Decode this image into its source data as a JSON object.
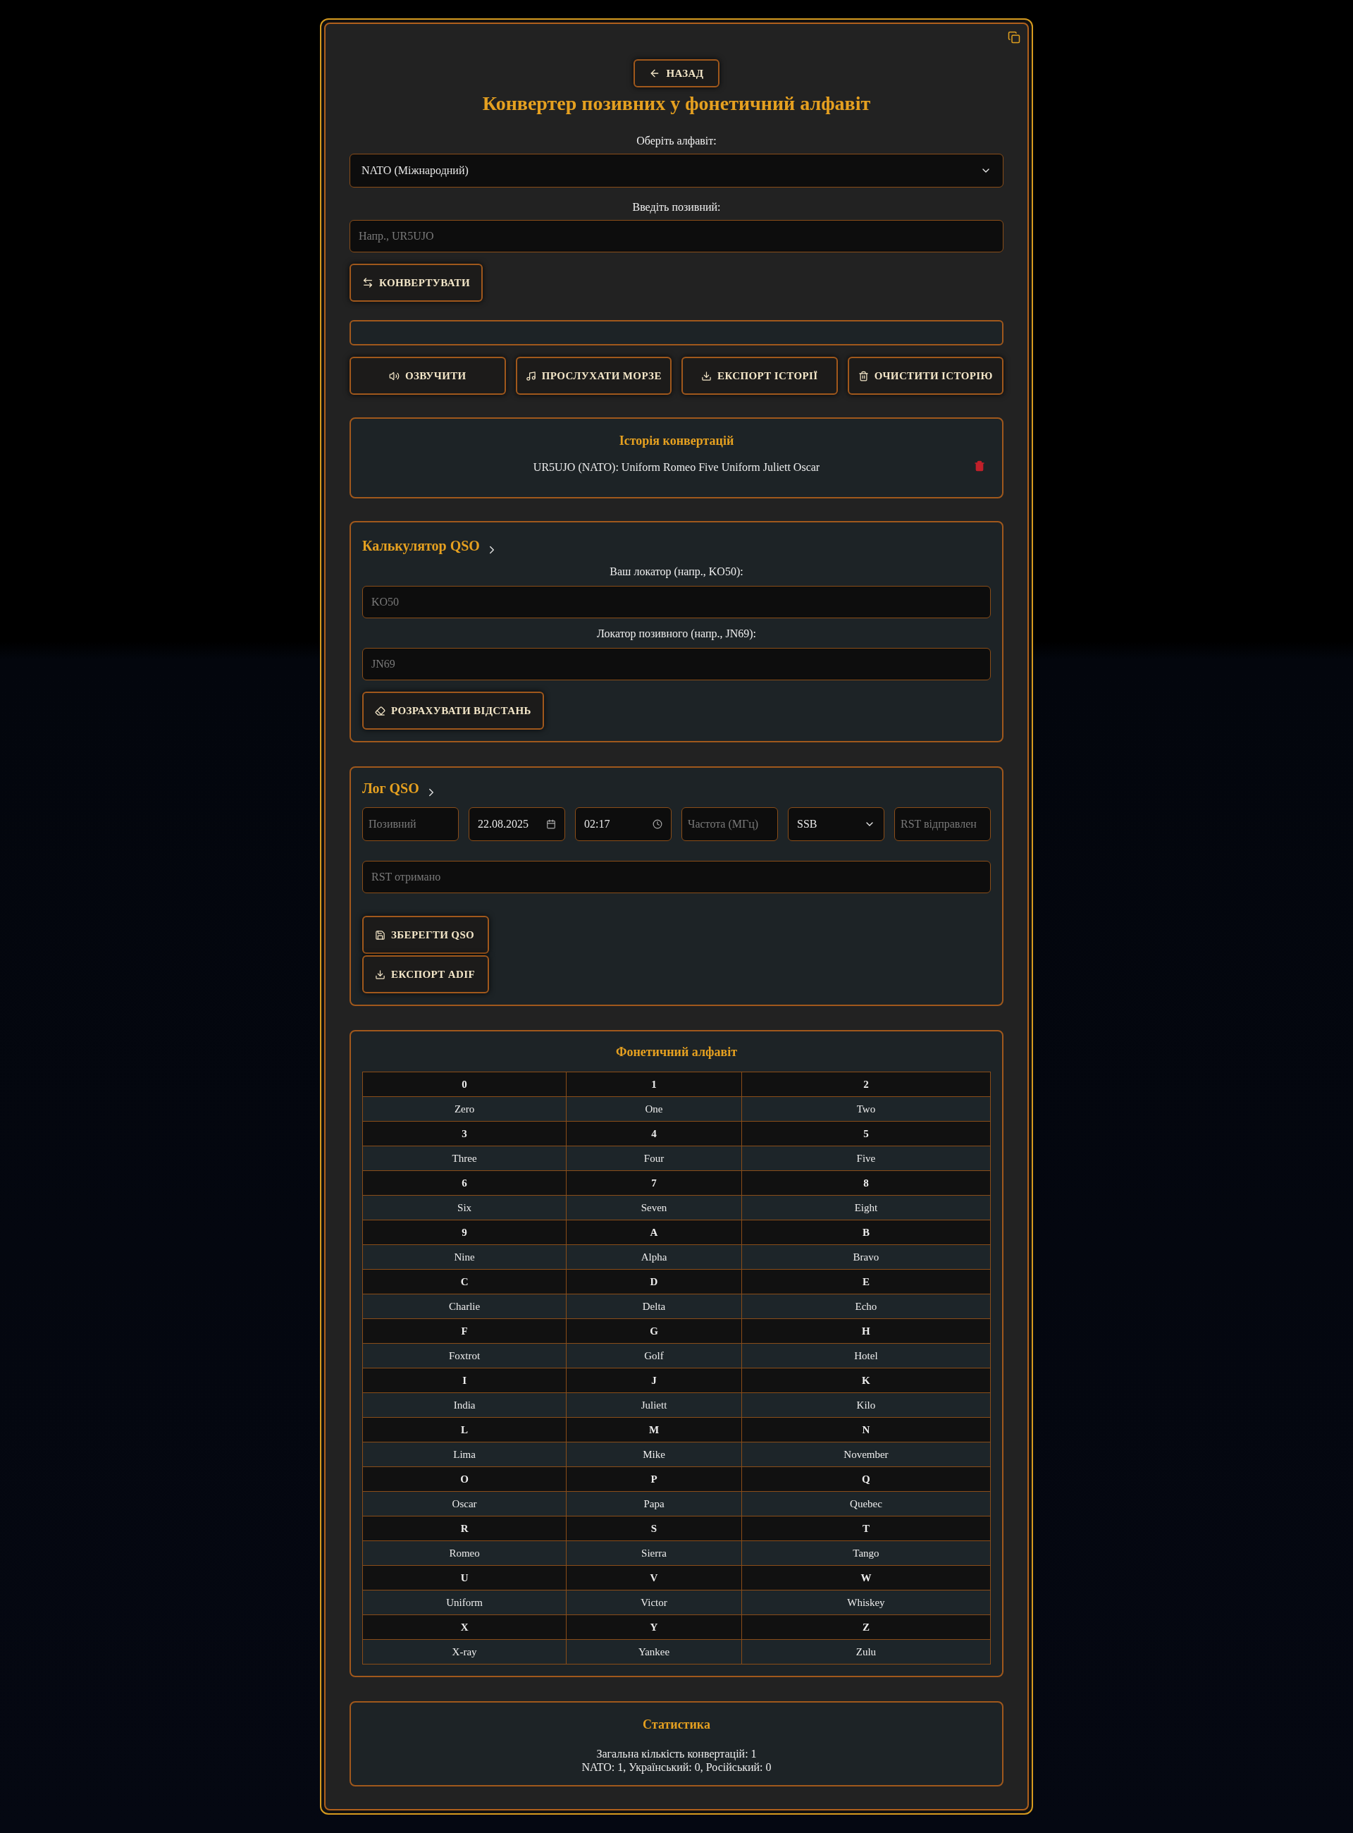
{
  "back_button": "НАЗАД",
  "title": "Конвертер позивних у фонетичний алфавіт",
  "alphabet": {
    "label": "Оберіть алфавіт:",
    "value": "NATO (Міжнародний)"
  },
  "callsign": {
    "label": "Введіть позивний:",
    "placeholder": "Напр., UR5UJO"
  },
  "convert_button": "КОНВЕРТУВАТИ",
  "actions": [
    "ОЗВУЧИТИ",
    "ПРОСЛУХАТИ МОРЗЕ",
    "ЕКСПОРТ ІСТОРІЇ",
    "ОЧИСТИТИ ІСТОРІЮ"
  ],
  "history": {
    "title": "Історія конвертацій",
    "items": [
      "UR5UJO (NATO): Uniform Romeo Five Uniform Juliett Oscar"
    ]
  },
  "qso_calculator": {
    "title": "Калькулятор QSO",
    "expanded": false,
    "fields": [
      {
        "label": "Ваш локатор (напр., KO50):",
        "placeholder": "KO50"
      },
      {
        "label": "Локатор позивного (напр., JN69):",
        "placeholder": "JN69"
      }
    ],
    "button": "РОЗРАХУВАТИ ВІДСТАНЬ"
  },
  "qso_log": {
    "title": "Лог QSO",
    "expanded": false,
    "fields": [
      {
        "kind": "text",
        "placeholder": "Позивний"
      },
      {
        "kind": "date",
        "value": "22.08.2025"
      },
      {
        "kind": "time",
        "value": "02:17"
      },
      {
        "kind": "text",
        "placeholder": "Частота (МГц)"
      },
      {
        "kind": "select",
        "value": "SSB"
      },
      {
        "kind": "text",
        "placeholder": "RST відправлен"
      }
    ],
    "rst_received": {
      "placeholder": "RST отримано"
    },
    "buttons": [
      "ЗБЕРЕГТИ QSO",
      "ЕКСПОРТ ADIF"
    ]
  },
  "phonetic_table": {
    "title": "Фонетичний алфавіт",
    "cells": [
      {
        "symbol": "0",
        "word": "Zero"
      },
      {
        "symbol": "1",
        "word": "One"
      },
      {
        "symbol": "2",
        "word": "Two"
      },
      {
        "symbol": "3",
        "word": "Three"
      },
      {
        "symbol": "4",
        "word": "Four"
      },
      {
        "symbol": "5",
        "word": "Five"
      },
      {
        "symbol": "6",
        "word": "Six"
      },
      {
        "symbol": "7",
        "word": "Seven"
      },
      {
        "symbol": "8",
        "word": "Eight"
      },
      {
        "symbol": "9",
        "word": "Nine"
      },
      {
        "symbol": "A",
        "word": "Alpha"
      },
      {
        "symbol": "B",
        "word": "Bravo"
      },
      {
        "symbol": "C",
        "word": "Charlie"
      },
      {
        "symbol": "D",
        "word": "Delta"
      },
      {
        "symbol": "E",
        "word": "Echo"
      },
      {
        "symbol": "F",
        "word": "Foxtrot"
      },
      {
        "symbol": "G",
        "word": "Golf"
      },
      {
        "symbol": "H",
        "word": "Hotel"
      },
      {
        "symbol": "I",
        "word": "India"
      },
      {
        "symbol": "J",
        "word": "Juliett"
      },
      {
        "symbol": "K",
        "word": "Kilo"
      },
      {
        "symbol": "L",
        "word": "Lima"
      },
      {
        "symbol": "M",
        "word": "Mike"
      },
      {
        "symbol": "N",
        "word": "November"
      },
      {
        "symbol": "O",
        "word": "Oscar"
      },
      {
        "symbol": "P",
        "word": "Papa"
      },
      {
        "symbol": "Q",
        "word": "Quebec"
      },
      {
        "symbol": "R",
        "word": "Romeo"
      },
      {
        "symbol": "S",
        "word": "Sierra"
      },
      {
        "symbol": "T",
        "word": "Tango"
      },
      {
        "symbol": "U",
        "word": "Uniform"
      },
      {
        "symbol": "V",
        "word": "Victor"
      },
      {
        "symbol": "W",
        "word": "Whiskey"
      },
      {
        "symbol": "X",
        "word": "X-ray"
      },
      {
        "symbol": "Y",
        "word": "Yankee"
      },
      {
        "symbol": "Z",
        "word": "Zulu"
      }
    ]
  },
  "statistics": {
    "title": "Статистика",
    "lines": [
      "Загальна кількість конвертацій: 1",
      "NATO: 1, Український: 0, Російський: 0"
    ]
  }
}
